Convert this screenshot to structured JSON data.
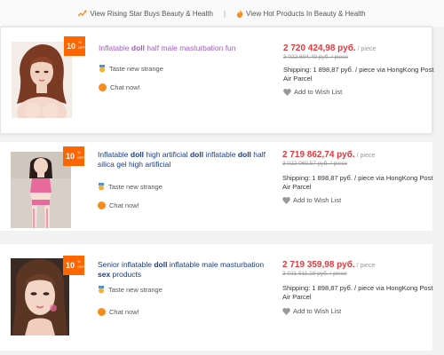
{
  "top_links": [
    {
      "label": "View Rising Star Buys Beauty & Health",
      "icon": "trend-icon"
    },
    {
      "label": "View Hot Products In Beauty & Health",
      "icon": "fire-icon"
    }
  ],
  "separator": "|",
  "colors": {
    "accent": "#f60",
    "price": "#e4393c",
    "title_visited": "#a35ac8",
    "title_link": "#1a3c8c"
  },
  "products": [
    {
      "title_parts": [
        "Inflatable ",
        "doll",
        " half male masturbation fun"
      ],
      "badge": {
        "percent": "10",
        "suffix": "% OFF"
      },
      "taste": "Taste new strange",
      "chat": "Chat now!",
      "price": "2 720 424,98 руб.",
      "unit": " / piece",
      "old_price": "3 022 694,49 руб. / piece",
      "shipping": "Shipping: 1 898,87 руб. / piece via HongKong Post Air Parcel",
      "wish": "Add to Wish List"
    },
    {
      "title_parts": [
        "Inflatable ",
        "doll",
        " high artificial ",
        "doll",
        " inflatable ",
        "doll",
        " half silica gel high artificial"
      ],
      "badge": {
        "percent": "10",
        "suffix": "% OFF"
      },
      "taste": "Taste new strange",
      "chat": "Chat now!",
      "price": "2 719 862,74 руб.",
      "unit": " / piece",
      "old_price": "3 022 069,57 руб. / piece",
      "shipping": "Shipping: 1 898,87 руб. / piece via HongKong Post Air Parcel",
      "wish": "Add to Wish List"
    },
    {
      "title_parts": [
        "Senior inflatable ",
        "doll",
        " inflatable male masturbation ",
        "sex",
        " products"
      ],
      "badge": {
        "percent": "10",
        "suffix": "% OFF"
      },
      "taste": "Taste new strange",
      "chat": "Chat now!",
      "price": "2 719 359,98 руб.",
      "unit": " / piece",
      "old_price": "3 021 511,19 руб. / piece",
      "shipping": "Shipping: 1 898,87 руб. / piece via HongKong Post Air Parcel",
      "wish": "Add to Wish List"
    }
  ]
}
